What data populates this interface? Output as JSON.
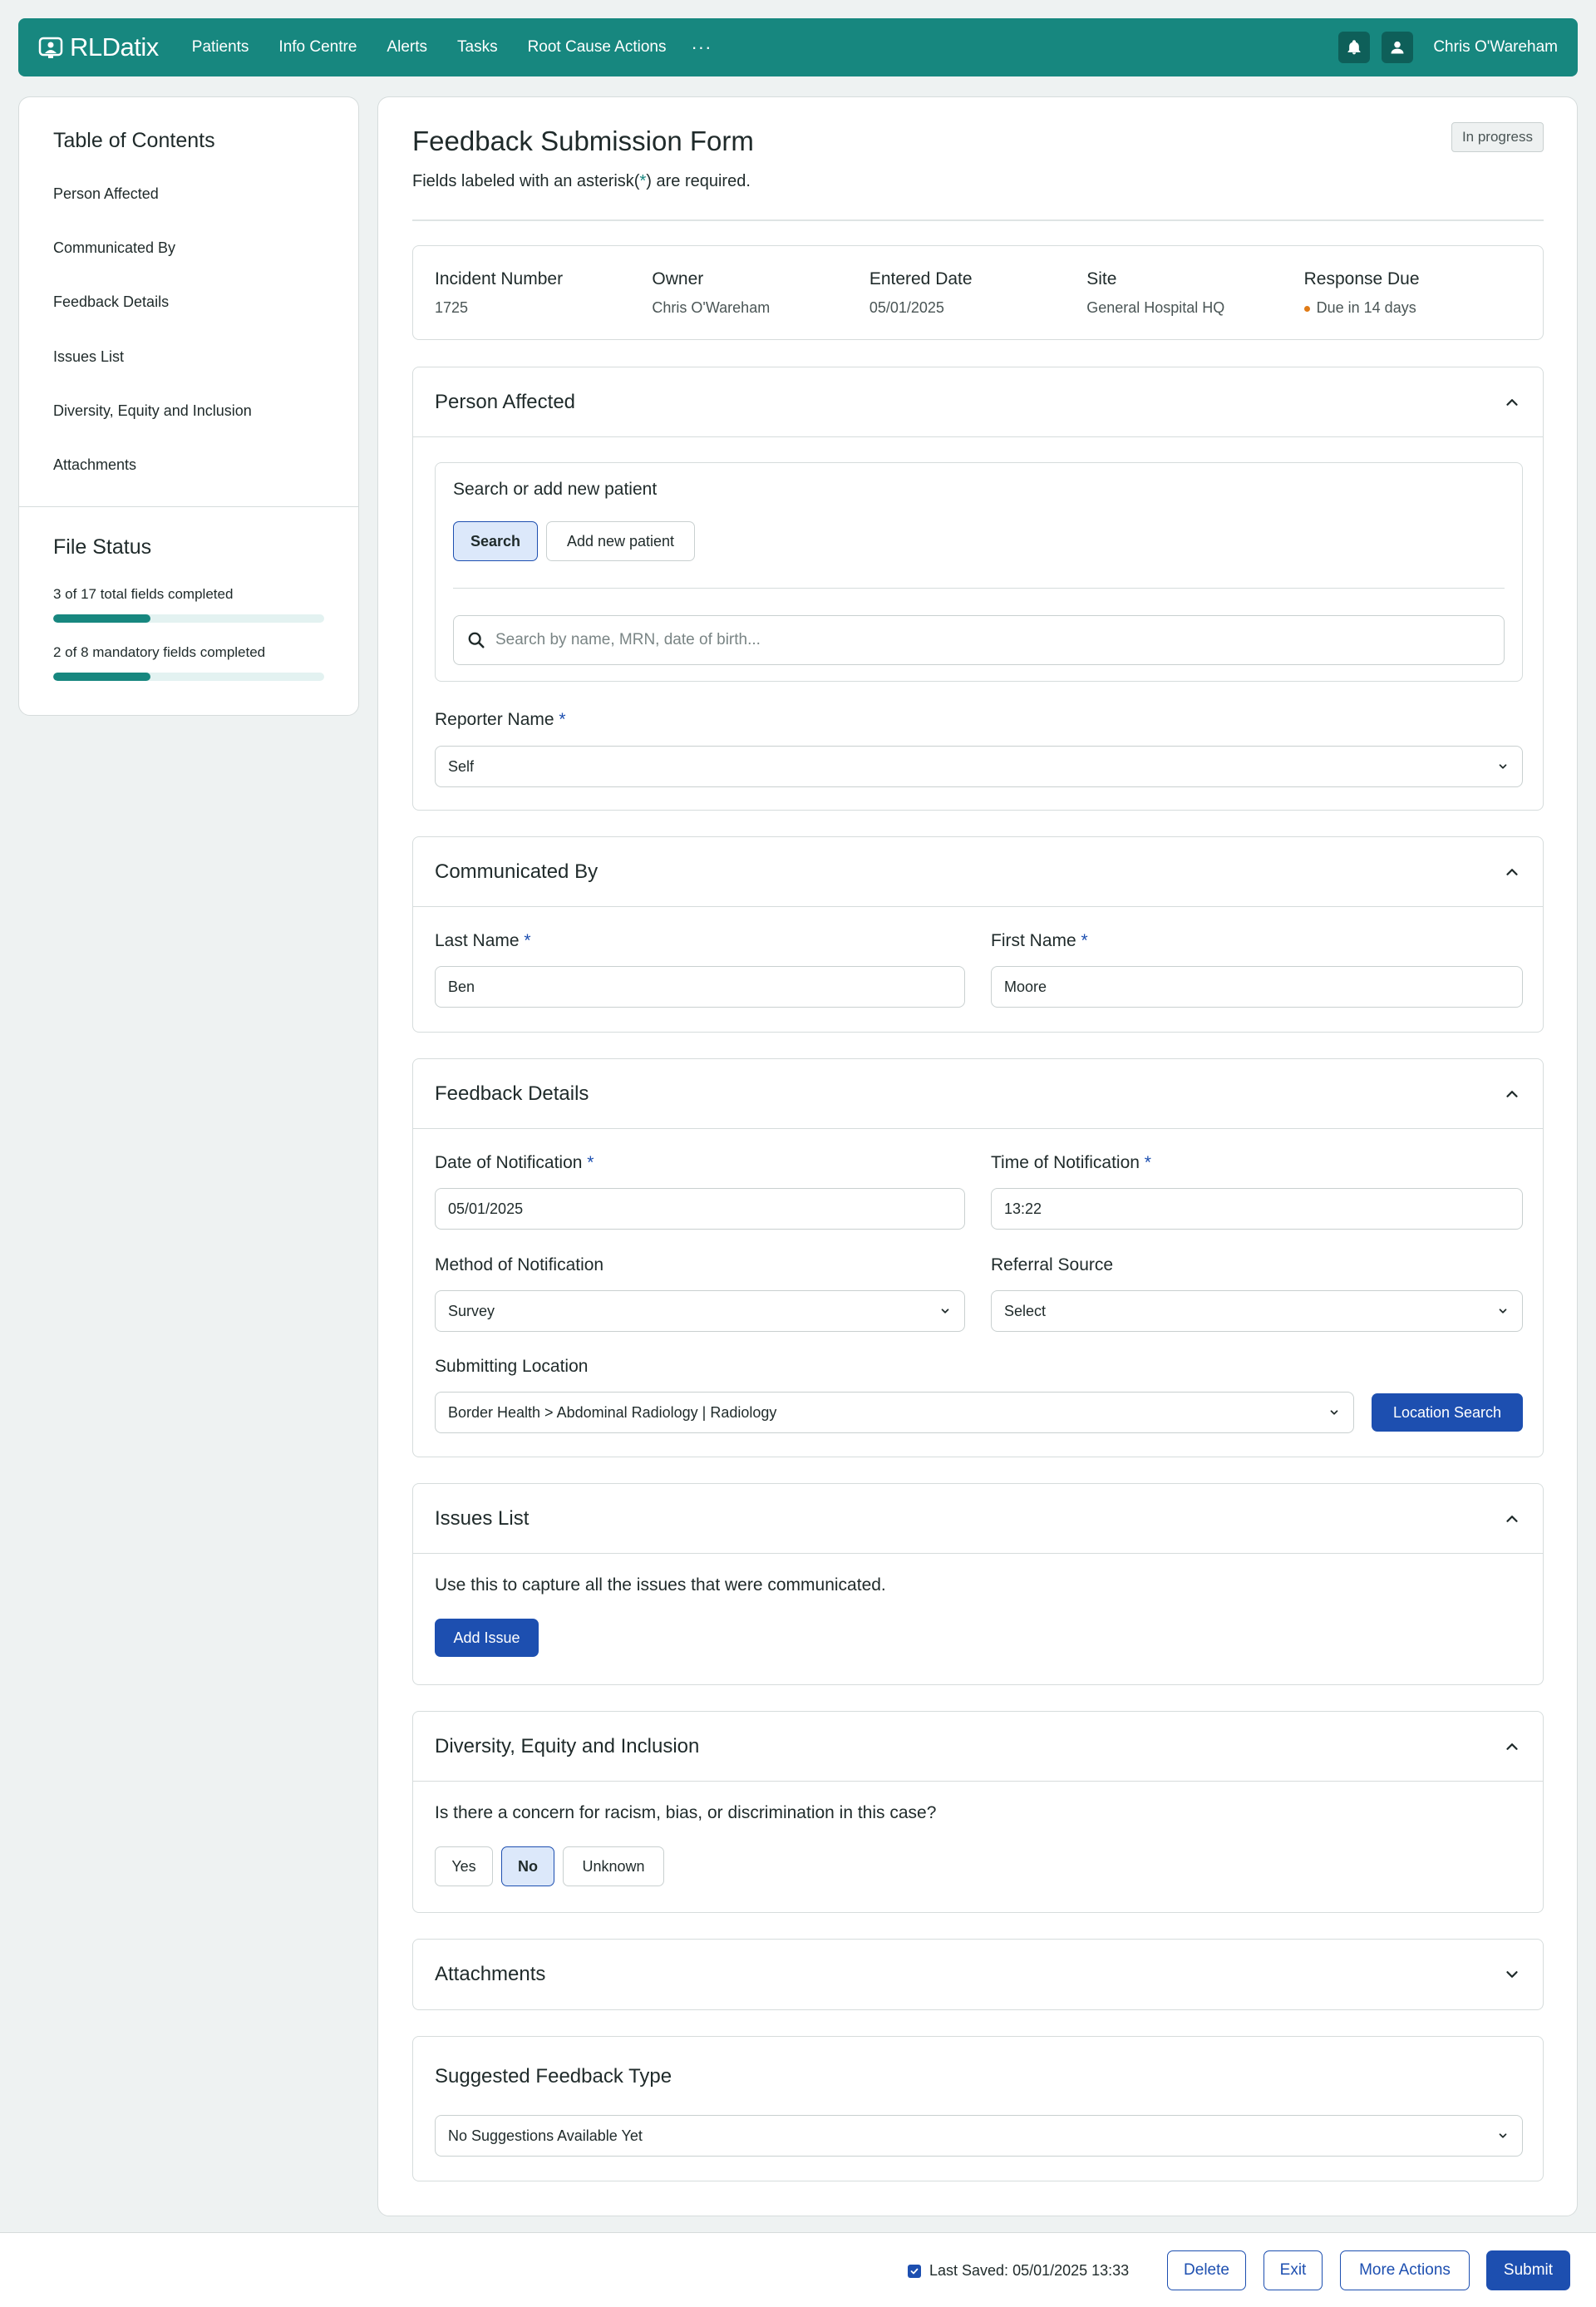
{
  "nav": {
    "brand": "RLDatix",
    "items": [
      "Patients",
      "Info Centre",
      "Alerts",
      "Tasks",
      "Root Cause Actions"
    ],
    "more": "···",
    "user": "Chris O'Wareham"
  },
  "sidebar": {
    "toc_title": "Table of Contents",
    "toc_items": [
      "Person Affected",
      "Communicated By",
      "Feedback Details",
      "Issues List",
      "Diversity, Equity and Inclusion",
      "Attachments"
    ],
    "file_status_title": "File Status",
    "total_label": "3 of 17 total fields completed",
    "total_progress": 0.36,
    "mandatory_label": "2 of 8 mandatory fields completed",
    "mandatory_progress": 0.36
  },
  "form": {
    "title": "Feedback Submission Form",
    "subtitle_before": "Fields labeled with an asterisk(",
    "subtitle_ast": "*",
    "subtitle_after": ") are required.",
    "status": "In progress"
  },
  "info": {
    "incident_label": "Incident Number",
    "incident_value": "1725",
    "owner_label": "Owner",
    "owner_value": "Chris O'Wareham",
    "entered_label": "Entered Date",
    "entered_value": "05/01/2025",
    "site_label": "Site",
    "site_value": "General Hospital HQ",
    "due_label": "Response Due",
    "due_value": "Due in 14 days"
  },
  "person_affected": {
    "title": "Person Affected",
    "search_heading": "Search or add new patient",
    "search_tab": "Search",
    "add_tab": "Add new patient",
    "search_placeholder": "Search by name, MRN, date of birth...",
    "reporter_label": "Reporter Name",
    "reporter_value": "Self",
    "required_mark": "*"
  },
  "communicated_by": {
    "title": "Communicated By",
    "last_label": "Last Name",
    "last_value": "Ben",
    "first_label": "First Name",
    "first_value": "Moore"
  },
  "feedback_details": {
    "title": "Feedback Details",
    "date_label": "Date of Notification",
    "date_value": "05/01/2025",
    "time_label": "Time of Notification",
    "time_value": "13:22",
    "method_label": "Method of Notification",
    "method_value": "Survey",
    "referral_label": "Referral Source",
    "referral_value": "Select",
    "location_label": "Submitting Location",
    "location_value": "Border Health > Abdominal Radiology | Radiology",
    "location_search": "Location Search"
  },
  "issues": {
    "title": "Issues List",
    "description": "Use this to capture all the issues that were communicated.",
    "add_button": "Add Issue"
  },
  "dei": {
    "title": "Diversity, Equity and Inclusion",
    "question": "Is there a concern for racism, bias, or discrimination in this case?",
    "options": [
      "Yes",
      "No",
      "Unknown"
    ],
    "selected": "No"
  },
  "attachments": {
    "title": "Attachments"
  },
  "suggested": {
    "title": "Suggested Feedback Type",
    "value": "No Suggestions Available Yet"
  },
  "footer": {
    "last_saved": "Last Saved: 05/01/2025 13:33",
    "delete": "Delete",
    "exit": "Exit",
    "more": "More Actions",
    "submit": "Submit"
  }
}
